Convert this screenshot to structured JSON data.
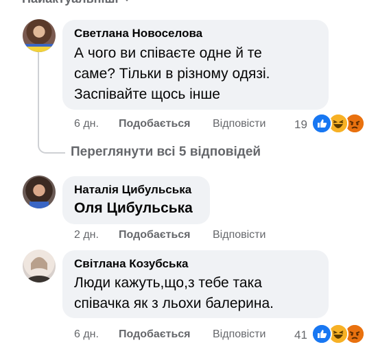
{
  "sort": {
    "label": "Найактуальніші"
  },
  "comments": [
    {
      "author": "Светлана Новоселова",
      "lines": [
        "А чого ви співаєте одне й те",
        "саме? Тільки в різному одязі.",
        "Заспівайте щось інше"
      ],
      "time": "6 дн.",
      "like": "Подобається",
      "reply": "Відповісти",
      "reactions_count": "19",
      "reactions": [
        "like-icon",
        "haha-icon",
        "angry-icon"
      ]
    },
    {
      "author": "Наталія Цибульська",
      "lines": [
        "Оля Цибульська"
      ],
      "time": "2 дн.",
      "like": "Подобається",
      "reply": "Відповісти"
    },
    {
      "author": "Світлана Козубська",
      "lines": [
        "Люди кажуть,що,з тебе така",
        "співачка як з льохи балерина."
      ],
      "time": "6 дн.",
      "like": "Подобається",
      "reply": "Відповісти",
      "reactions_count": "41",
      "reactions": [
        "like-icon",
        "haha-icon",
        "angry-icon"
      ]
    }
  ],
  "view_replies": "Переглянути всі 5 відповідей",
  "colors": {
    "bubble": "#f0f2f5",
    "meta": "#65676b",
    "like": "#1877f2",
    "haha": "#f7b125",
    "angry": "#e9710f"
  }
}
